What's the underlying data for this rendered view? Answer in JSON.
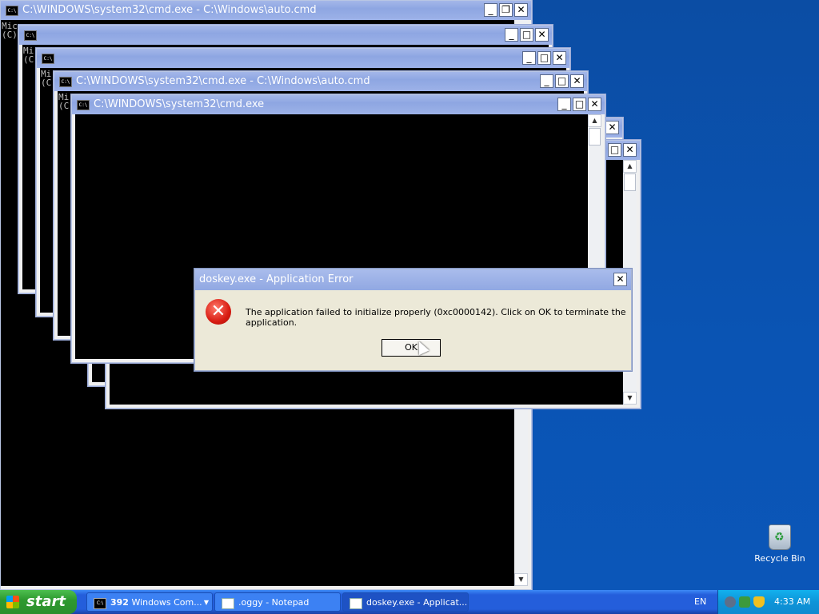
{
  "windows": [
    {
      "title": "C:\\WINDOWS\\system32\\cmd.exe - C:\\Windows\\auto.cmd",
      "lines": [
        "Mic",
        "(C)"
      ]
    },
    {
      "title": "",
      "lines": [
        "Mi",
        "(C"
      ]
    },
    {
      "title": "",
      "lines": [
        "Mi",
        "(C"
      ]
    },
    {
      "title": "C:\\WINDOWS\\system32\\cmd.exe - C:\\Windows\\auto.cmd",
      "lines": [
        "Mi",
        "(C"
      ]
    },
    {
      "title": "C:\\WINDOWS\\system32\\cmd.exe",
      "lines": []
    }
  ],
  "cmd_icon_text": "C:\\",
  "dialog": {
    "title": "doskey.exe - Application Error",
    "message": "The application failed to initialize properly (0xc0000142). Click on OK to terminate the application.",
    "ok_label": "OK",
    "close_glyph": "✕",
    "error_glyph": "✕"
  },
  "window_buttons": {
    "minimize": "_",
    "maximize": "□",
    "restore": "❐",
    "close": "✕"
  },
  "desktop": {
    "recycle_bin_label": "Recycle Bin"
  },
  "taskbar": {
    "start_label": "start",
    "buttons": [
      {
        "count": "392",
        "label": "Windows Com..."
      },
      {
        "label": ".oggy - Notepad"
      },
      {
        "label": "doskey.exe - Applicat..."
      }
    ],
    "language": "EN",
    "clock": "4:33 AM"
  }
}
